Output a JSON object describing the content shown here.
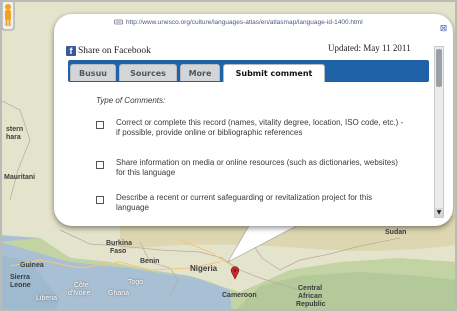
{
  "popup": {
    "url": "http://www.unesco.org/culture/languages-atlas/en/atlasmap/language-id-1400.html",
    "share_label": "Share on Facebook",
    "updated": "Updated: May 11 2011",
    "tabs": [
      {
        "label": "Busuu"
      },
      {
        "label": "Sources"
      },
      {
        "label": "More"
      },
      {
        "label": "Submit comment",
        "active": true
      }
    ],
    "form": {
      "heading": "Type of Comments:",
      "options": [
        {
          "text": "Correct or complete this record (names, vitality degree, location, ISO code, etc.) - if possible, provide online or bibliographic references",
          "checked": false
        },
        {
          "text": "Share information on media or online resources (such as dictionaries, websites) for this language",
          "checked": false
        },
        {
          "text": "Describe a recent or current safeguarding or revitalization project for this language",
          "checked": false
        }
      ]
    }
  },
  "map": {
    "labels": {
      "stern": "stern",
      "hara": "hara",
      "mauritani": "Mauritani",
      "sudan": "Sudan",
      "burkina": "Burkina",
      "faso": "Faso",
      "benin": "Benin",
      "nigeria": "Nigeria",
      "guinea": "Guinea",
      "sierra": "Sierra",
      "leone": "Leone",
      "cote": "Côte",
      "divoire": "d'Ivoire",
      "ghana": "Ghana",
      "togo": "Togo",
      "liberia": "Liberia",
      "cameroon": "Cameroon",
      "central": "Central",
      "african": "African",
      "republic": "Republic"
    },
    "marker_color": "#cc2a2a",
    "water_color": "#a7bfd4",
    "land_color": "#e4e2c6"
  }
}
